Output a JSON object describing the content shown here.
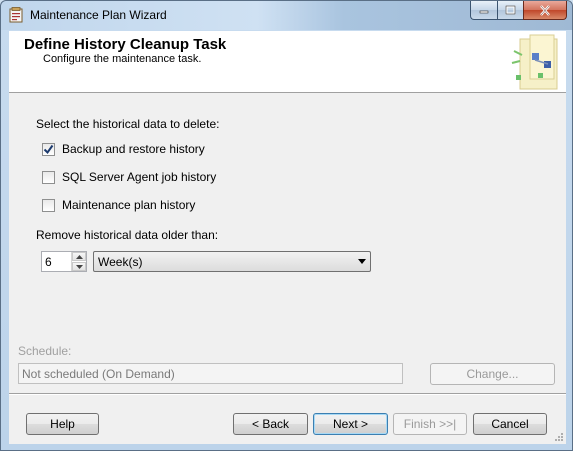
{
  "window": {
    "title": "Maintenance Plan Wizard"
  },
  "header": {
    "title": "Define History Cleanup Task",
    "subtitle": "Configure the maintenance task."
  },
  "form": {
    "select_label": "Select the historical data to delete:",
    "options": [
      {
        "label": "Backup and restore history",
        "checked": true
      },
      {
        "label": "SQL Server Agent job history",
        "checked": false
      },
      {
        "label": "Maintenance plan history",
        "checked": false
      }
    ],
    "remove_label": "Remove historical data older than:",
    "age_value": "6",
    "age_unit": "Week(s)"
  },
  "schedule": {
    "label": "Schedule:",
    "value": "Not scheduled (On Demand)",
    "change_label": "Change..."
  },
  "buttons": {
    "help": "Help",
    "back": "< Back",
    "next": "Next >",
    "finish": "Finish >>|",
    "cancel": "Cancel"
  },
  "colors": {
    "titlebar": "#c0d6ec",
    "close_button": "#c0472a",
    "dialog_bg": "#f0f0f0",
    "default_button_border": "#3c7fb1"
  }
}
